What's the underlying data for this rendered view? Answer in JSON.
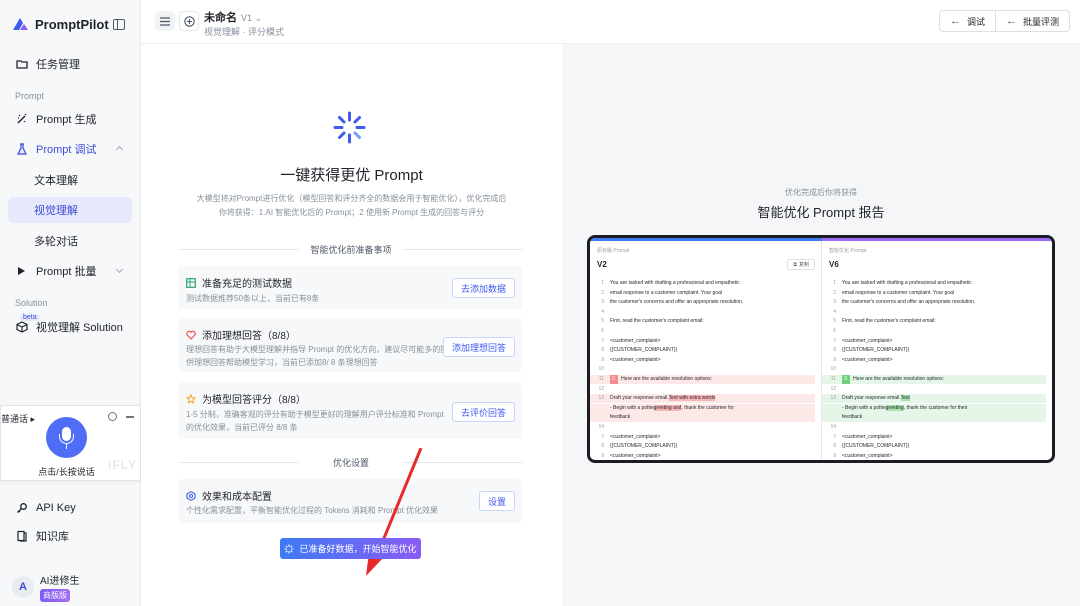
{
  "brand": {
    "name": "PromptPilot"
  },
  "sidebar": {
    "task_mgmt": "任务管理",
    "section_prompt": "Prompt",
    "prompt_gen": "Prompt 生成",
    "prompt_debug": "Prompt 调试",
    "text_understanding": "文本理解",
    "visual_understanding": "视觉理解",
    "multi_turn": "多轮对话",
    "prompt_batch": "Prompt 批量",
    "section_solution": "Solution",
    "beta": "beta",
    "visual_solution": "视觉理解 Solution",
    "api_key": "API Key",
    "knowledge": "知识库"
  },
  "voice_widget": {
    "label": "普通话",
    "hint": "点击/长按说话",
    "watermark": "iFLY"
  },
  "user": {
    "initial": "A",
    "name": "AI进修生",
    "badge": "商版版"
  },
  "header": {
    "title": "未命名",
    "version": "V1",
    "breadcrumb": "视觉理解 · 评分模式",
    "debug_btn": "调试",
    "batch_eval_btn": "批量评测"
  },
  "main": {
    "title": "一键获得更优 Prompt",
    "desc": "大模型将对Prompt进行优化（模型回答和评分齐全的数据会用于智能优化），优化完成后你将获得：1.AI 智能优化后的 Prompt；2.使用新 Prompt 生成的回答与评分",
    "prep_label": "智能优化前准备事项",
    "cards": [
      {
        "title": "准备充足的测试数据",
        "desc": "测试数据推荐50条以上，当前已有8条",
        "button": "去添加数据"
      },
      {
        "title": "添加理想回答（8/8）",
        "desc": "理想回答有助于大模型理解并指导 Prompt 的优化方向，建议尽可能多的提供理想回答帮助模型学习，当前已添加8/ 8 条理想回答",
        "button": "添加理想回答"
      },
      {
        "title": "为模型回答评分（8/8）",
        "desc": "1-5 分制，准确客观的评分有助于模型更好的理解用户评分标准和 Prompt 的优化效果，当前已评分 8/8 条",
        "button": "去评价回答"
      }
    ],
    "opt_label": "优化设置",
    "settings_card": {
      "title": "效果和成本配置",
      "desc": "个性化需求配置，平衡智能优化过程的 Tokens 消耗和 Prompt 优化效果",
      "button": "设置"
    },
    "start_button": "已准备好数据，开始智能优化"
  },
  "right": {
    "subtitle": "优化完成后你将获得",
    "title": "智能优化 Prompt 报告",
    "preview": {
      "left_head": "原有版 Prompt",
      "left_version": "V2",
      "copy": "复制",
      "right_head": "智能优化 Prompt",
      "right_version": "V6",
      "left_lines": [
        {
          "n": "1",
          "t": "You are tasked with drafting a professional and empathetic"
        },
        {
          "n": "2",
          "t": "email response to a customer complaint. Your goal"
        },
        {
          "n": "3",
          "t": "the customer's concerns and offer an appropriate resolution."
        },
        {
          "n": "4",
          "t": ""
        },
        {
          "n": "5",
          "t": "First, read the customer's complaint email:"
        },
        {
          "n": "6",
          "t": ""
        },
        {
          "n": "7",
          "t": "<customer_complaint>"
        },
        {
          "n": "8",
          "t": "{{CUSTOMER_COMPLAINT}}"
        },
        {
          "n": "9",
          "t": "<customer_complaint>"
        },
        {
          "n": "10",
          "t": ""
        },
        {
          "n": "11",
          "tag": "2.",
          "t": "Here are the available resolution options:"
        },
        {
          "n": "12",
          "t": ""
        },
        {
          "n": "13",
          "pre": "Draft your response email.",
          "hl": "Text with extra words",
          "post": ""
        },
        {
          "n": "",
          "pre": "- Begin with a polite",
          "hl": "greeting and",
          "post": ", thank the customer for"
        },
        {
          "n": "",
          "t": "feedback"
        },
        {
          "n": "14",
          "t": ""
        },
        {
          "n": "7",
          "t": "<customer_complaint>"
        },
        {
          "n": "8",
          "t": "{{CUSTOMER_COMPLAINT}}"
        },
        {
          "n": "9",
          "t": "<customer_complaint>"
        }
      ],
      "right_lines": [
        {
          "n": "1",
          "t": "You are tasked with drafting a professional and empathetic"
        },
        {
          "n": "2",
          "t": "email response to a customer complaint. Your goal"
        },
        {
          "n": "3",
          "t": "the customer's concerns and offer an appropriate resolution."
        },
        {
          "n": "4",
          "t": ""
        },
        {
          "n": "5",
          "t": "First, read the customer's complaint email:"
        },
        {
          "n": "6",
          "t": ""
        },
        {
          "n": "7",
          "t": "<customer_complaint>"
        },
        {
          "n": "8",
          "t": "{{CUSTOMER_COMPLAINT}}"
        },
        {
          "n": "9",
          "t": "<customer_complaint>"
        },
        {
          "n": "10",
          "t": ""
        },
        {
          "n": "11",
          "tag": "3.",
          "t": "Here are the available resolution options:"
        },
        {
          "n": "12",
          "t": ""
        },
        {
          "n": "13",
          "pre": "Draft your response email.",
          "hl": "Text",
          "post": ""
        },
        {
          "n": "",
          "pre": "- Begin with a polite",
          "hl": "greeting",
          "post": ", thank the customer for their"
        },
        {
          "n": "",
          "t": "feedback"
        },
        {
          "n": "14",
          "t": ""
        },
        {
          "n": "7",
          "t": "<customer_complaint>"
        },
        {
          "n": "8",
          "t": "{{CUSTOMER_COMPLAINT}}"
        },
        {
          "n": "9",
          "t": "<customer_complaint>"
        }
      ]
    }
  },
  "colors": {
    "accent": "#3d5af1",
    "active_bg": "#e6e9fb",
    "start_from": "#3d7bf5",
    "start_to": "#8a5cf6"
  }
}
